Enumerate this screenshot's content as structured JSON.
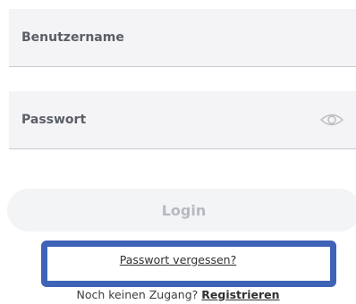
{
  "form": {
    "username_placeholder": "Benutzername",
    "password_placeholder": "Passwort",
    "password_toggle_icon": "eye-icon",
    "login_label": "Login",
    "forgot_password_label": "Passwort vergessen?",
    "no_account_text": "Noch keinen Zugang?",
    "register_label": "Registrieren"
  },
  "colors": {
    "field_background": "#f4f4f6",
    "button_background": "#f3f4f6",
    "button_text_disabled": "#b6b9bf",
    "highlight_border": "#3f63b6"
  }
}
